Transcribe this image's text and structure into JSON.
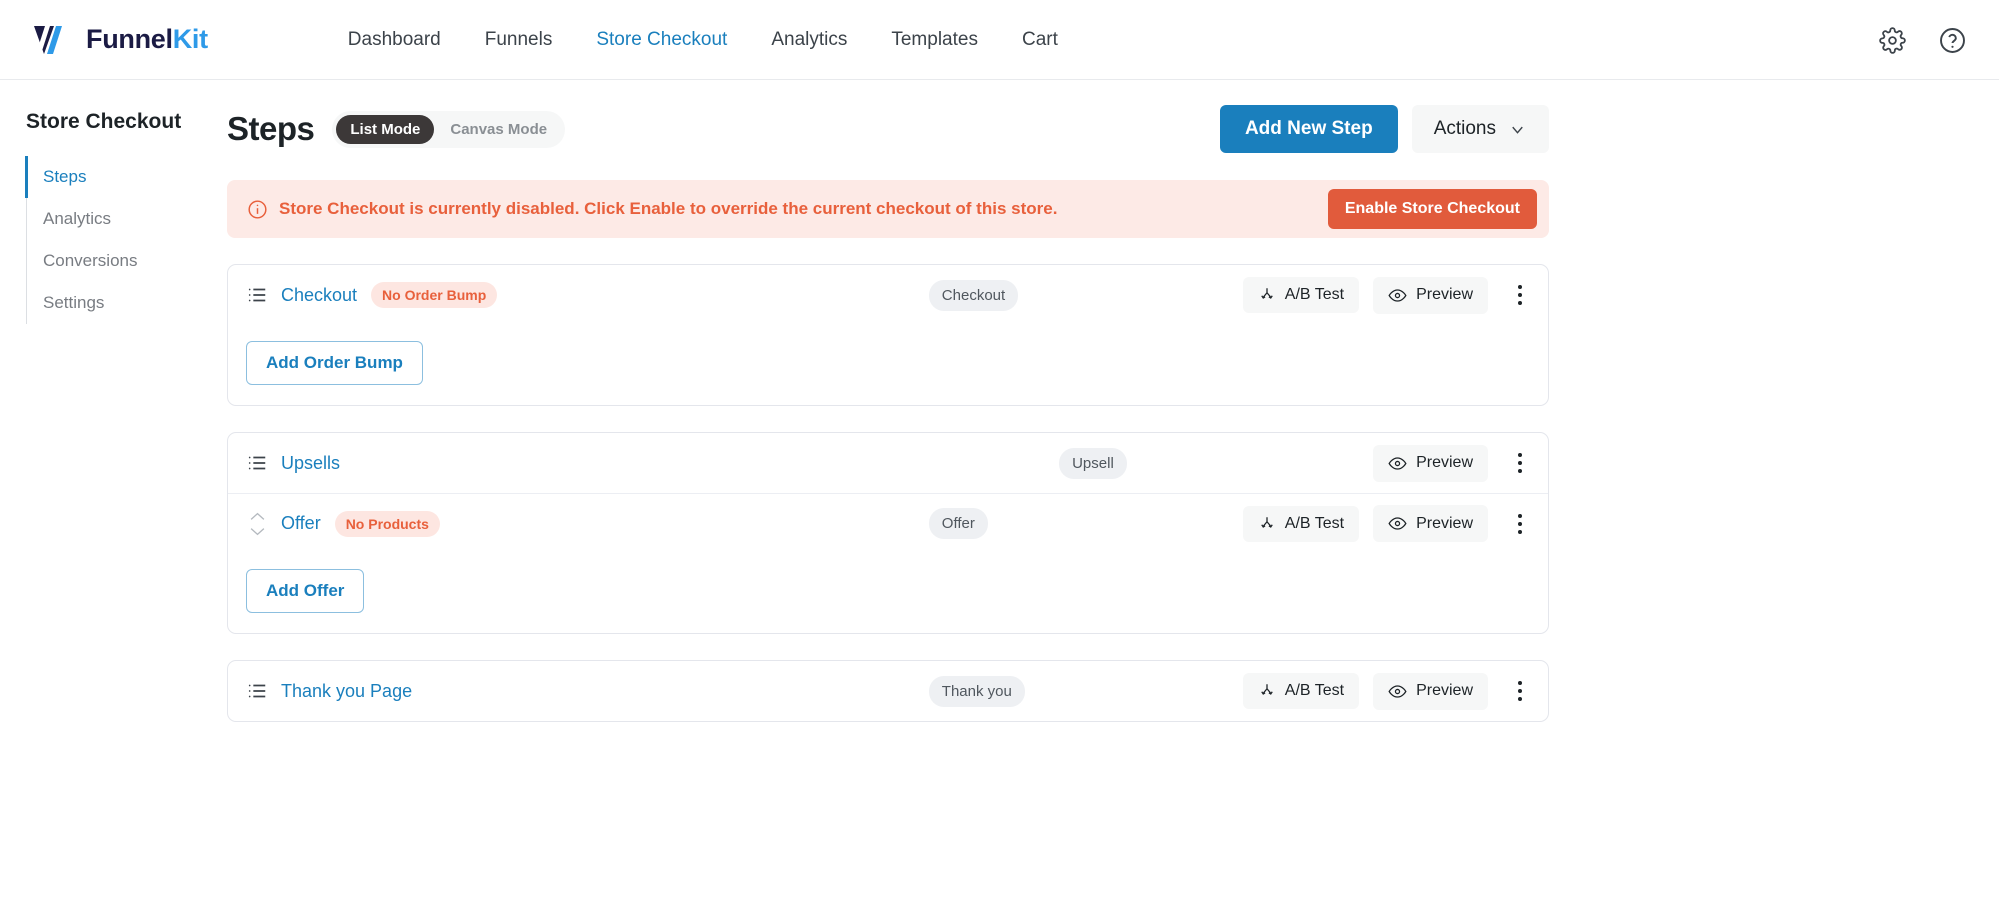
{
  "topbar": {
    "logo_text_primary": "Funnel",
    "logo_text_accent": "Kit",
    "nav": [
      {
        "label": "Dashboard",
        "active": false
      },
      {
        "label": "Funnels",
        "active": false
      },
      {
        "label": "Store Checkout",
        "active": true
      },
      {
        "label": "Analytics",
        "active": false
      },
      {
        "label": "Templates",
        "active": false
      },
      {
        "label": "Cart",
        "active": false
      }
    ],
    "settings_icon": "gear-icon",
    "help_icon": "question-circle-icon"
  },
  "sidebar": {
    "title": "Store Checkout",
    "items": [
      {
        "label": "Steps",
        "active": true
      },
      {
        "label": "Analytics",
        "active": false
      },
      {
        "label": "Conversions",
        "active": false
      },
      {
        "label": "Settings",
        "active": false
      }
    ]
  },
  "header": {
    "title": "Steps",
    "mode_list": "List Mode",
    "mode_canvas": "Canvas Mode",
    "add_new_step": "Add New Step",
    "actions": "Actions",
    "actions_chevron": "chevron-down-icon"
  },
  "alert": {
    "icon": "info-circle-icon",
    "message": "Store Checkout is currently disabled. Click Enable to override the current checkout of this store.",
    "button": "Enable Store Checkout"
  },
  "labels": {
    "ab_test": "A/B Test",
    "preview": "Preview",
    "ab_icon": "ab-split-icon",
    "eye_icon": "eye-icon",
    "kebab_icon": "kebab-menu-icon",
    "list_icon": "list-lines-icon",
    "sort_icon": "sort-up-down-icon"
  },
  "cards": [
    {
      "name": "checkout-card",
      "rows": [
        {
          "name": "Checkout",
          "tag": "No Order Bump",
          "badge": "Checkout",
          "has_ab": true,
          "has_preview": true,
          "sortable": false
        }
      ],
      "add_button": "Add Order Bump"
    },
    {
      "name": "upsells-card",
      "rows": [
        {
          "name": "Upsells",
          "tag": "",
          "badge": "Upsell",
          "has_ab": false,
          "has_preview": true,
          "sortable": false
        },
        {
          "name": "Offer",
          "tag": "No Products",
          "badge": "Offer",
          "has_ab": true,
          "has_preview": true,
          "sortable": true
        }
      ],
      "add_button": "Add Offer"
    },
    {
      "name": "thankyou-card",
      "rows": [
        {
          "name": "Thank you Page",
          "tag": "",
          "badge": "Thank you",
          "has_ab": true,
          "has_preview": true,
          "sortable": false
        }
      ],
      "add_button": ""
    }
  ],
  "colors": {
    "brand_blue": "#1a7fbd",
    "logo_navy": "#1b1b44",
    "logo_cyan": "#2e9ae8",
    "alert_bg": "#fdeae6",
    "alert_text": "#e8603c",
    "alert_button": "#e15b3c",
    "badge_bg": "#eef0f3"
  }
}
